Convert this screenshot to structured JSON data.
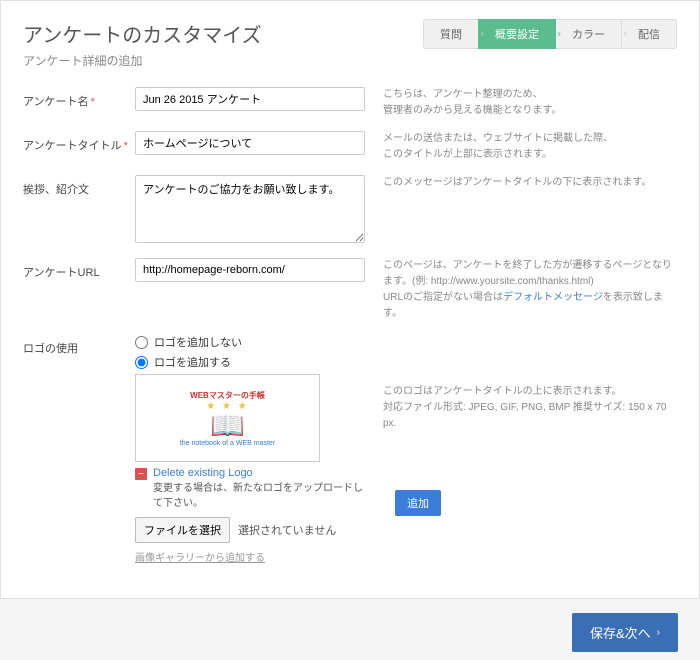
{
  "header": {
    "title": "アンケートのカスタマイズ",
    "subtitle": "アンケート詳細の追加"
  },
  "tabs": [
    {
      "label": "質問",
      "active": false
    },
    {
      "label": "概要設定",
      "active": true
    },
    {
      "label": "カラー",
      "active": false
    },
    {
      "label": "配信",
      "active": false
    }
  ],
  "fields": {
    "name": {
      "label": "アンケート名",
      "value": "Jun 26 2015 アンケート",
      "help1": "こちらは、アンケート整理のため、",
      "help2": "管理者のみから見える機能となります。"
    },
    "title": {
      "label": "アンケートタイトル",
      "value": "ホームページについて",
      "help1": "メールの送信または、ウェブサイトに掲載した際、",
      "help2": "このタイトルが上部に表示されます。"
    },
    "intro": {
      "label": "挨拶、紹介文",
      "value": "アンケートのご協力をお願い致します。",
      "help1": "このメッセージはアンケートタイトルの下に表示されます。"
    },
    "url": {
      "label": "アンケートURL",
      "value": "http://homepage-reborn.com/",
      "help1": "このページは、アンケートを終了した方が遷移するページとなります。(例: http://www.yoursite.com/thanks.html)",
      "help2a": "URLのご指定がない場合は",
      "help2link": "デフォルトメッセージ",
      "help2b": "を表示致します。"
    },
    "logo": {
      "label": "ロゴの使用",
      "radio_no": "ロゴを追加しない",
      "radio_yes": "ロゴを追加する",
      "help1": "このロゴはアンケートタイトルの上に表示されます。",
      "help2": "対応ファイル形式: JPEG, GIF, PNG, BMP  推奨サイズ: 150 x 70 px.",
      "preview_ribbon": "WEBマスターの手帳",
      "preview_caption": "the notebook of a WEB master",
      "delete_link": "Delete existing Logo",
      "delete_note": "変更する場合は、新たなロゴをアップロードして下さい。",
      "file_button": "ファイルを選択",
      "file_status": "選択されていません",
      "add_button": "追加",
      "gallery_link": "画像ギャラリーから追加する"
    }
  },
  "footer": {
    "next": "保存&次へ"
  }
}
